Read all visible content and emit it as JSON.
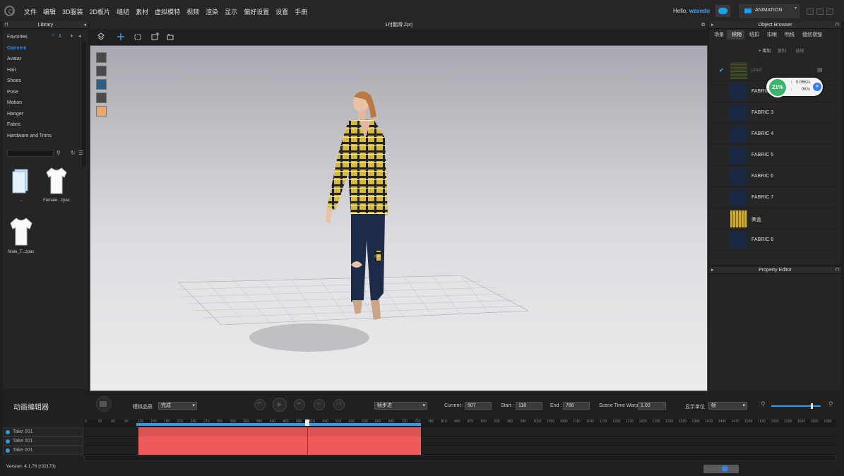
{
  "menu": {
    "items": [
      "文件",
      "编辑",
      "3D服装",
      "2D板片",
      "缝纫",
      "素材",
      "虚拟模特",
      "视频",
      "渲染",
      "显示",
      "偏好设置",
      "设置",
      "手册"
    ],
    "greeting": "Hello,",
    "user": "wzuedu",
    "mode": "ANIMATION"
  },
  "library": {
    "title": "Library",
    "items": [
      "Favorites",
      "Garment",
      "Avatar",
      "Hair",
      "Shoes",
      "Pose",
      "Motion",
      "Hanger",
      "Fabric",
      "Hardware and Trims"
    ],
    "active": "Garment",
    "thumbs": [
      {
        "label": "..",
        "icon": "folder-icon"
      },
      {
        "label": "Female...zpac",
        "icon": "tshirt-icon"
      },
      {
        "label": "Male_T...zpac",
        "icon": "tshirt-icon"
      }
    ]
  },
  "viewport": {
    "file_title": "1付翻滑.Zprj"
  },
  "object_browser": {
    "title": "Object Browser",
    "tabs": [
      "场景",
      "织物",
      "纽扣",
      "扣眼",
      "明线",
      "缝纫褶皱"
    ],
    "active_tab": "织物",
    "actions": [
      "+ 增加",
      "复制",
      "选择"
    ],
    "fabrics": [
      {
        "name": "plaid",
        "pattern": "plaid",
        "checked": true
      },
      {
        "name": "FABRIC 1",
        "pattern": "navy"
      },
      {
        "name": "FABRIC 3",
        "pattern": "navy"
      },
      {
        "name": "FABRIC 4",
        "pattern": "navy"
      },
      {
        "name": "FABRIC 5",
        "pattern": "navy"
      },
      {
        "name": "FABRIC 6",
        "pattern": "navy"
      },
      {
        "name": "FABRIC 7",
        "pattern": "navy"
      },
      {
        "name": "荣盖",
        "pattern": "plaid"
      },
      {
        "name": "FABRIC 8",
        "pattern": "navy"
      }
    ]
  },
  "net_widget": {
    "percent": "21%",
    "up": "0.06K/s",
    "down": "0K/s"
  },
  "property_editor": {
    "title": "Property Editor"
  },
  "animation": {
    "title": "动画编辑器",
    "sim_quality_label": "模拟品质",
    "sim_quality_value": "完成",
    "step_value": "帧步进",
    "current_label": "Current :",
    "current_value": "507",
    "start_label": "Start :",
    "start_value": "118",
    "end_label": "End :",
    "end_value": "766",
    "warp_label": "Scene Time Warp",
    "warp_value": "1.00",
    "unit_label": "显示单位",
    "unit_value": "帧",
    "ticks": [
      "0",
      "30",
      "60",
      "90",
      "120",
      "150",
      "180",
      "210",
      "240",
      "270",
      "300",
      "330",
      "360",
      "390",
      "420",
      "450",
      "480",
      "510",
      "540",
      "570",
      "600",
      "630",
      "660",
      "690",
      "720",
      "750",
      "780",
      "810",
      "840",
      "870",
      "900",
      "930",
      "960",
      "990",
      "1020",
      "1050",
      "1080",
      "1110",
      "1140",
      "1170",
      "1200",
      "1230",
      "1260",
      "1290",
      "1320",
      "1350",
      "1380",
      "1410",
      "1440",
      "1470",
      "1500",
      "1530",
      "1560",
      "1590",
      "1620",
      "1650",
      "1680"
    ],
    "tracks": [
      "Take 001",
      "Take 001",
      "Take 001"
    ],
    "version": "Version: 4.1.76 (r32173)"
  }
}
